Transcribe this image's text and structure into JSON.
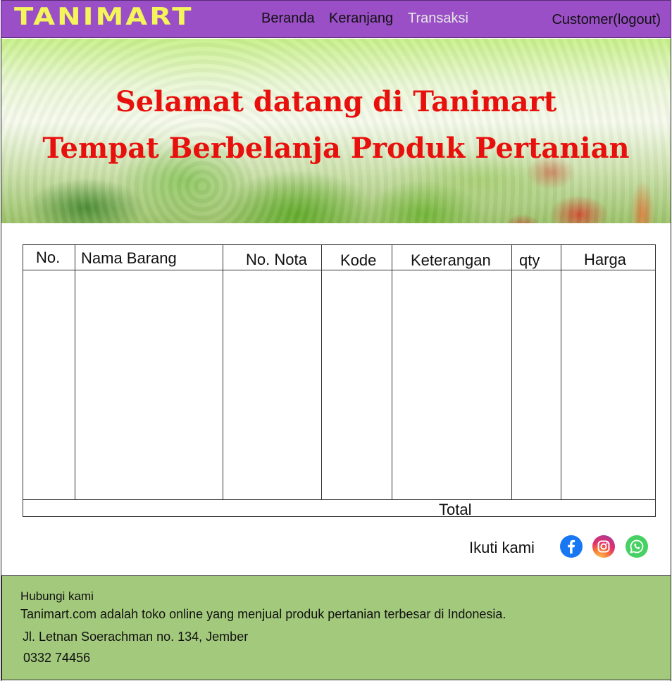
{
  "brand": {
    "logo_text": "TANIMART"
  },
  "nav": {
    "items": [
      {
        "label": "Beranda",
        "active": false
      },
      {
        "label": "Keranjang",
        "active": false
      },
      {
        "label": "Transaksi",
        "active": true
      }
    ],
    "user_label": "Customer(logout)"
  },
  "banner": {
    "line1": "Selamat datang di Tanimart",
    "line2": "Tempat Berbelanja Produk Pertanian"
  },
  "table": {
    "headers": [
      "No.",
      "Nama Barang",
      "No. Nota",
      "Kode",
      "Keterangan",
      "qty",
      "Harga"
    ],
    "rows": [],
    "total_label": "Total"
  },
  "follow": {
    "label": "Ikuti kami",
    "icons": [
      "facebook-icon",
      "instagram-icon",
      "whatsapp-icon"
    ]
  },
  "footer": {
    "heading": "Hubungi kami",
    "description": "Tanimart.com adalah toko online yang menjual produk pertanian terbesar di Indonesia.",
    "address": "Jl. Letnan Soerachman no. 134, Jember",
    "phone": "0332 74456"
  },
  "colors": {
    "navbar": "#9b4fc7",
    "logo": "#f3f55a",
    "banner_text": "#e8100c",
    "footer": "#a3c97c"
  }
}
